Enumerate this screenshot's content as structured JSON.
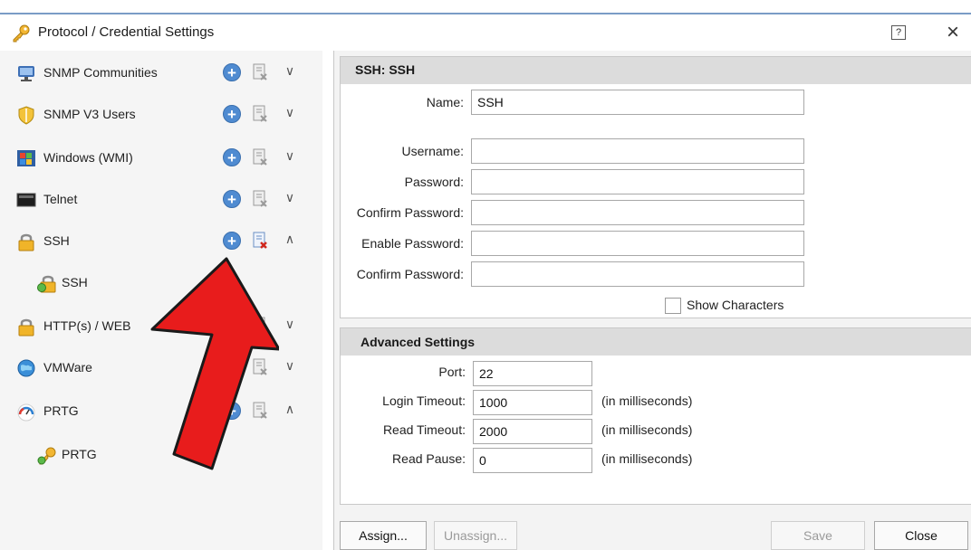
{
  "window": {
    "title": "Protocol / Credential Settings",
    "help_label": "?",
    "close_label": "×"
  },
  "categories": [
    {
      "label": "SNMP Communities",
      "icon": "snmp-network-icon",
      "expanded": false
    },
    {
      "label": "SNMP V3 Users",
      "icon": "shield-icon",
      "expanded": false
    },
    {
      "label": "Windows (WMI)",
      "icon": "windows-icon",
      "expanded": false
    },
    {
      "label": "Telnet",
      "icon": "terminal-icon",
      "expanded": false
    },
    {
      "label": "SSH",
      "icon": "lock-icon",
      "expanded": true,
      "children": [
        {
          "label": "SSH",
          "icon": "key-lock-icon"
        }
      ]
    },
    {
      "label": "HTTP(s) / WEB",
      "icon": "lock-icon",
      "expanded": false
    },
    {
      "label": "VMWare",
      "icon": "globe-icon",
      "expanded": false
    },
    {
      "label": "PRTG",
      "icon": "gauge-icon",
      "expanded": true,
      "children": [
        {
          "label": "PRTG",
          "icon": "key-icon"
        }
      ]
    }
  ],
  "chevrons": {
    "collapsed": "∨",
    "expanded": "∧"
  },
  "add_symbol": "+",
  "form": {
    "header": "SSH: SSH",
    "name_label": "Name:",
    "name_value": "SSH",
    "username_label": "Username:",
    "password_label": "Password:",
    "confirm_password_label": "Confirm Password:",
    "enable_password_label": "Enable Password:",
    "confirm_password2_label": "Confirm Password:",
    "show_characters_label": "Show Characters"
  },
  "advanced": {
    "header": "Advanced Settings",
    "port_label": "Port:",
    "port_value": "22",
    "login_timeout_label": "Login Timeout:",
    "login_timeout_value": "1000",
    "read_timeout_label": "Read Timeout:",
    "read_timeout_value": "2000",
    "read_pause_label": "Read Pause:",
    "read_pause_value": "0",
    "unit_hint": "(in milliseconds)"
  },
  "buttons": {
    "assign": "Assign...",
    "unassign": "Unassign...",
    "save": "Save",
    "close": "Close"
  },
  "colors": {
    "arrow": "#e81c1c",
    "add_button": "#4f8bd1",
    "delete_active": "#d0281e"
  }
}
